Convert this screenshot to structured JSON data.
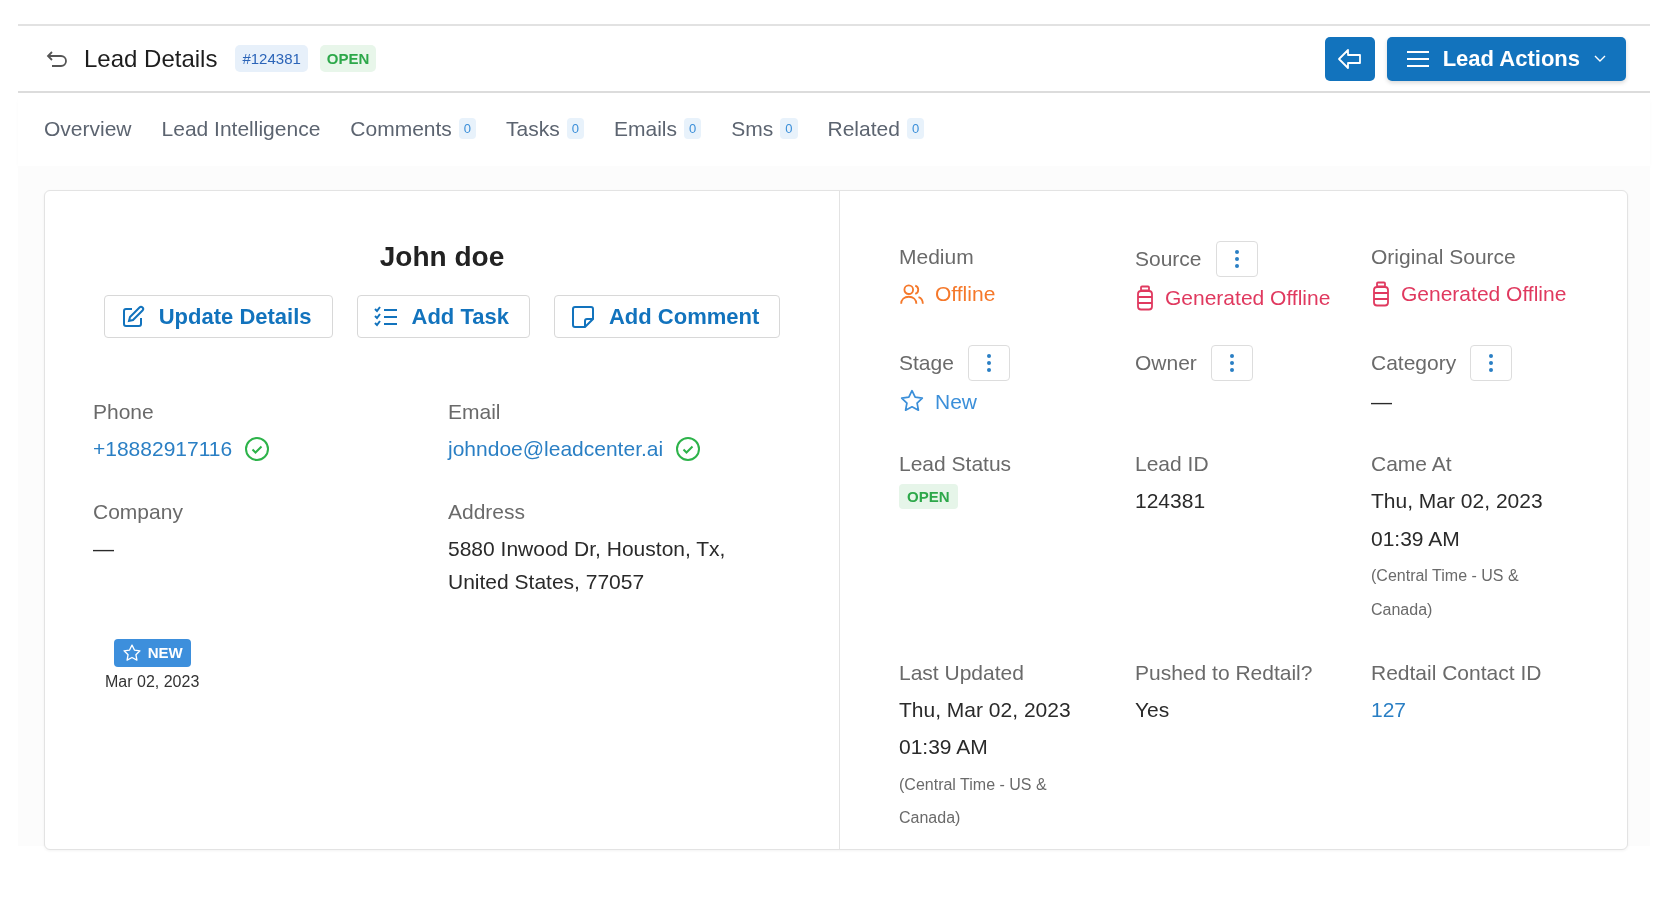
{
  "header": {
    "title": "Lead Details",
    "lead_number": "#124381",
    "status": "OPEN",
    "actions_button": "Lead Actions"
  },
  "tabs": [
    {
      "label": "Overview",
      "selected": false
    },
    {
      "label": "Lead Intelligence",
      "selected": false
    },
    {
      "label": "Comments",
      "count": "0",
      "selected": false
    },
    {
      "label": "Tasks",
      "count": "0",
      "selected": false
    },
    {
      "label": "Emails",
      "count": "0",
      "selected": false
    },
    {
      "label": "Sms",
      "count": "0",
      "selected": false
    },
    {
      "label": "Related",
      "count": "0",
      "selected": false
    }
  ],
  "contact": {
    "name": "John doe",
    "buttons": [
      {
        "kind": "edit",
        "label": "Update Details"
      },
      {
        "kind": "task",
        "label": "Add Task"
      },
      {
        "kind": "comment",
        "label": "Add Comment"
      }
    ],
    "fields": [
      {
        "label": "Phone",
        "kind": "link",
        "value": "+18882917116",
        "verified": true
      },
      {
        "label": "Email",
        "kind": "link",
        "value": "johndoe@leadcenter.ai",
        "verified": true
      },
      {
        "label": "Company",
        "kind": "text",
        "value": "—"
      },
      {
        "label": "Address",
        "kind": "text",
        "value": "5880 Inwood Dr, Houston, Tx, United States, 77057"
      }
    ],
    "stage_badge": "NEW",
    "created": "Mar 02, 2023"
  },
  "details": [
    {
      "label": "Medium",
      "menu": false,
      "kind": "people",
      "color": "#f5782a",
      "value": "Offline"
    },
    {
      "label": "Source",
      "menu": true,
      "kind": "bottle",
      "color": "#e0395f",
      "value": "Generated Offline"
    },
    {
      "label": "Original Source",
      "menu": false,
      "kind": "bottle",
      "color": "#e0395f",
      "value": "Generated Offline"
    },
    {
      "label": "Stage",
      "menu": true,
      "kind": "star",
      "color": "#3b8fd9",
      "value": "New"
    },
    {
      "label": "Owner",
      "menu": true,
      "kind": "none"
    },
    {
      "label": "Category",
      "menu": true,
      "kind": "text",
      "value": "—"
    },
    {
      "label": "Lead Status",
      "menu": false,
      "kind": "badge",
      "value": "OPEN"
    },
    {
      "label": "Lead ID",
      "menu": false,
      "kind": "text",
      "value": "124381"
    },
    {
      "label": "Came At",
      "menu": false,
      "kind": "datetime",
      "lines": [
        "Thu, Mar 02, 2023",
        "01:39 AM"
      ],
      "note": "(Central Time - US & Canada)"
    },
    {
      "label": "Last Updated",
      "menu": false,
      "kind": "datetime",
      "lines": [
        "Thu, Mar 02, 2023",
        "01:39 AM"
      ],
      "note": "(Central Time - US & Canada)"
    },
    {
      "label": "Pushed to Redtail?",
      "menu": false,
      "kind": "text",
      "value": "Yes"
    },
    {
      "label": "Redtail Contact ID",
      "menu": false,
      "kind": "link",
      "value": "127"
    }
  ]
}
